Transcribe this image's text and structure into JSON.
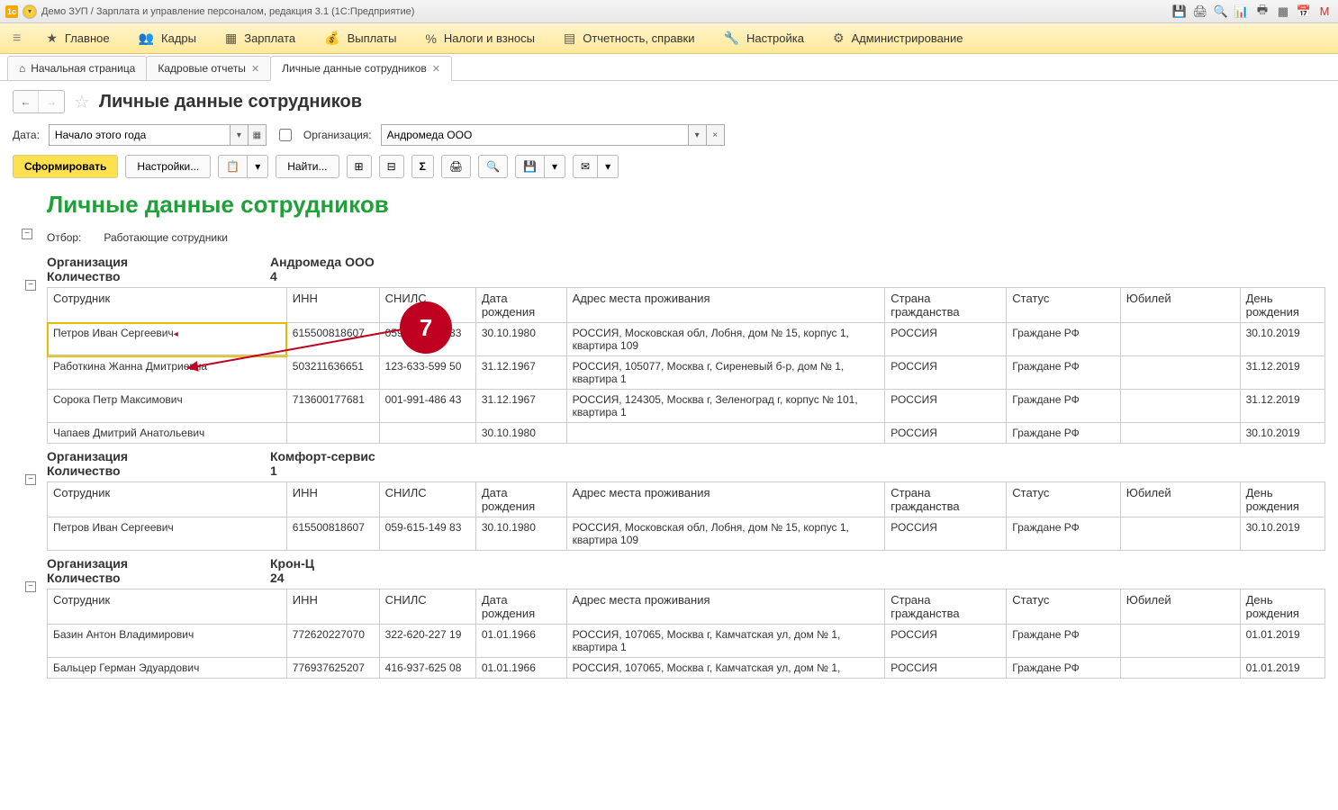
{
  "window": {
    "title": "Демо ЗУП / Зарплата и управление персоналом, редакция 3.1  (1С:Предприятие)"
  },
  "menu": {
    "items": [
      "Главное",
      "Кадры",
      "Зарплата",
      "Выплаты",
      "Налоги и взносы",
      "Отчетность, справки",
      "Настройка",
      "Администрирование"
    ]
  },
  "tabs": [
    {
      "label": "Начальная страница",
      "close": false,
      "home": true
    },
    {
      "label": "Кадровые отчеты",
      "close": true
    },
    {
      "label": "Личные данные сотрудников",
      "close": true,
      "active": true
    }
  ],
  "page": {
    "title": "Личные данные сотрудников"
  },
  "filters": {
    "date_label": "Дата:",
    "date_value": "Начало этого года",
    "org_label": "Организация:",
    "org_value": "Андромеда ООО"
  },
  "toolbar": {
    "form": "Сформировать",
    "settings": "Настройки...",
    "find": "Найти..."
  },
  "report": {
    "title": "Личные данные сотрудников",
    "filter_label": "Отбор:",
    "filter_value": "Работающие сотрудники",
    "org_label": "Организация",
    "count_label": "Количество",
    "headers": {
      "emp": "Сотрудник",
      "inn": "ИНН",
      "snils": "СНИЛС",
      "dob": "Дата рождения",
      "addr": "Адрес места проживания",
      "country": "Страна гражданства",
      "status": "Статус",
      "jub": "Юбилей",
      "bday": "День рождения"
    },
    "groups": [
      {
        "org": "Андромеда ООО",
        "count": "4",
        "rows": [
          {
            "emp": "Петров Иван Сергеевич",
            "inn": "615500818607",
            "snils": "059-615-149 83",
            "dob": "30.10.1980",
            "addr": "РОССИЯ, Московская обл, Лобня, дом № 15, корпус 1, квартира 109",
            "country": "РОССИЯ",
            "status": "Граждане РФ",
            "jub": "",
            "bday": "30.10.2019",
            "sel": true
          },
          {
            "emp": "Работкина Жанна Дмитриевна",
            "inn": "503211636651",
            "snils": "123-633-599 50",
            "dob": "31.12.1967",
            "addr": "РОССИЯ, 105077, Москва г, Сиреневый б-р, дом № 1, квартира 1",
            "country": "РОССИЯ",
            "status": "Граждане РФ",
            "jub": "",
            "bday": "31.12.2019"
          },
          {
            "emp": "Сорока Петр Максимович",
            "inn": "713600177681",
            "snils": "001-991-486 43",
            "dob": "31.12.1967",
            "addr": "РОССИЯ, 124305, Москва г, Зеленоград г, корпус № 101, квартира 1",
            "country": "РОССИЯ",
            "status": "Граждане РФ",
            "jub": "",
            "bday": "31.12.2019"
          },
          {
            "emp": "Чапаев Дмитрий Анатольевич",
            "inn": "",
            "snils": "",
            "dob": "30.10.1980",
            "addr": "",
            "country": "РОССИЯ",
            "status": "Граждане РФ",
            "jub": "",
            "bday": "30.10.2019"
          }
        ]
      },
      {
        "org": "Комфорт-сервис",
        "count": "1",
        "rows": [
          {
            "emp": "Петров Иван Сергеевич",
            "inn": "615500818607",
            "snils": "059-615-149 83",
            "dob": "30.10.1980",
            "addr": "РОССИЯ, Московская обл, Лобня, дом № 15, корпус 1, квартира 109",
            "country": "РОССИЯ",
            "status": "Граждане РФ",
            "jub": "",
            "bday": "30.10.2019"
          }
        ]
      },
      {
        "org": "Крон-Ц",
        "count": "24",
        "rows": [
          {
            "emp": "Базин Антон Владимирович",
            "inn": "772620227070",
            "snils": "322-620-227 19",
            "dob": "01.01.1966",
            "addr": "РОССИЯ, 107065, Москва г, Камчатская ул, дом № 1, квартира 1",
            "country": "РОССИЯ",
            "status": "Граждане РФ",
            "jub": "",
            "bday": "01.01.2019"
          },
          {
            "emp": "Бальцер Герман Эдуардович",
            "inn": "776937625207",
            "snils": "416-937-625 08",
            "dob": "01.01.1966",
            "addr": "РОССИЯ, 107065, Москва г, Камчатская ул, дом № 1,",
            "country": "РОССИЯ",
            "status": "Граждане РФ",
            "jub": "",
            "bday": "01.01.2019"
          }
        ]
      }
    ]
  },
  "callout": {
    "num": "7"
  }
}
